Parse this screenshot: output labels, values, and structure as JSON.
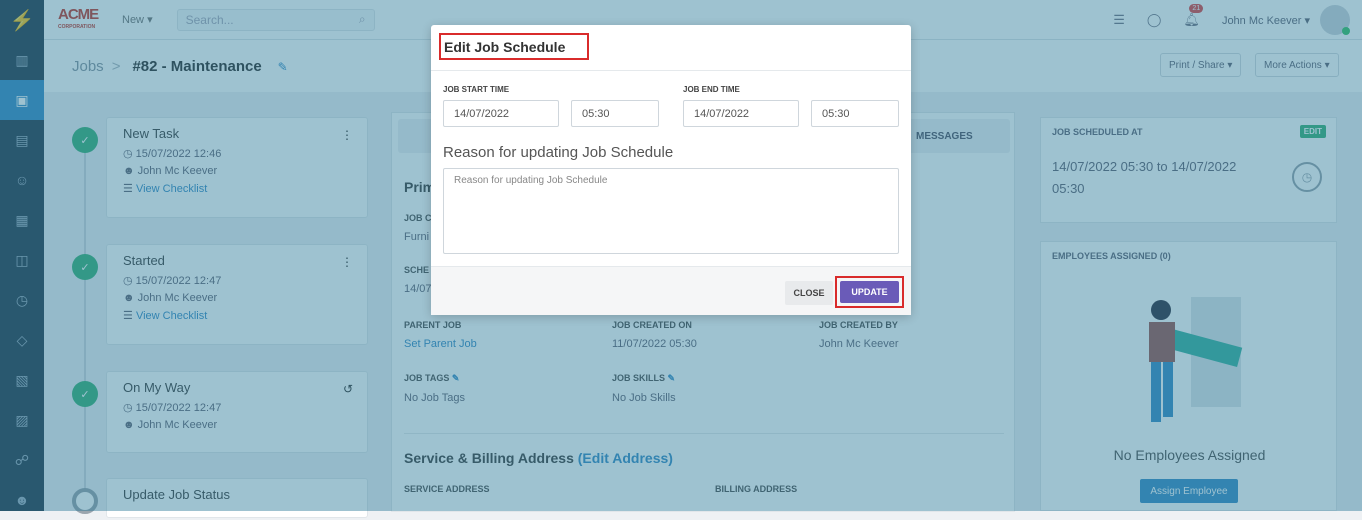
{
  "topbar": {
    "brand": "ACME",
    "brand_sub": "CORPORATION",
    "new_label": "New",
    "search_placeholder": "Search...",
    "notif_count": "21",
    "user_name": "John Mc Keever"
  },
  "crumb": {
    "jobs": "Jobs",
    "sep": ">",
    "job": "#82 - Maintenance"
  },
  "buttons": {
    "print": "Print / Share",
    "more": "More Actions"
  },
  "timeline": [
    {
      "title": "New Task",
      "time": "15/07/2022 12:46",
      "user": "John Mc Keever",
      "checklist": "View Checklist"
    },
    {
      "title": "Started",
      "time": "15/07/2022 12:47",
      "user": "John Mc Keever",
      "checklist": "View Checklist"
    },
    {
      "title": "On My Way",
      "time": "15/07/2022 12:47",
      "user": "John Mc Keever"
    },
    {
      "title": "Update Job Status"
    }
  ],
  "details": {
    "tab_messages": "MESSAGES",
    "section_title": "Prim",
    "job_c_lbl": "JOB C",
    "job_c_val": "Furni",
    "sched_lbl": "SCHE",
    "sched_val": "14/07",
    "parent_job_lbl": "PARENT JOB",
    "parent_job_val": "Set Parent Job",
    "created_on_lbl": "JOB CREATED ON",
    "created_on_val": "11/07/2022 05:30",
    "created_by_lbl": "JOB CREATED BY",
    "created_by_val": "John Mc Keever",
    "tags_lbl": "JOB TAGS",
    "tags_val": "No Job Tags",
    "skills_lbl": "JOB SKILLS",
    "skills_val": "No Job Skills",
    "address_title": "Service & Billing Address",
    "address_edit": "(Edit Address)",
    "service_lbl": "SERVICE ADDRESS",
    "billing_lbl": "BILLING ADDRESS"
  },
  "scheduled": {
    "label": "JOB SCHEDULED AT",
    "edit": "EDIT",
    "value": "14/07/2022 05:30 to 14/07/2022 05:30"
  },
  "employees": {
    "label": "EMPLOYEES ASSIGNED (0)",
    "empty": "No Employees Assigned",
    "assign": "Assign Employee"
  },
  "modal": {
    "title": "Edit Job Schedule",
    "start_lbl": "JOB START TIME",
    "end_lbl": "JOB END TIME",
    "start_date": "14/07/2022",
    "start_time": "05:30",
    "end_date": "14/07/2022",
    "end_time": "05:30",
    "reason_lbl": "Reason for updating Job Schedule",
    "reason_placeholder": "Reason for updating Job Schedule",
    "close": "CLOSE",
    "update": "UPDATE"
  }
}
